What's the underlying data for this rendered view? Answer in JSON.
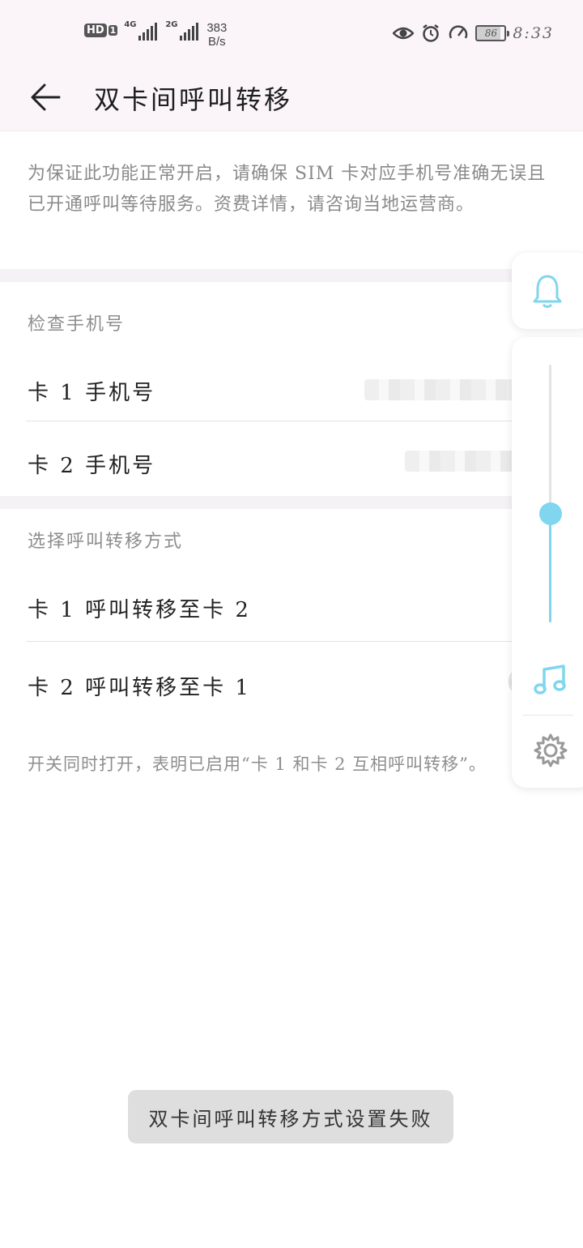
{
  "status_bar": {
    "hd_badge": "HD",
    "hd_sim": "1",
    "sim1_network": "4G",
    "sim2_network": "2G",
    "speed_value": "383",
    "speed_unit": "B/s",
    "battery_level": "86",
    "time": "8:33",
    "icons": [
      "eye-icon",
      "alarm-icon",
      "speedometer-icon",
      "battery-icon"
    ]
  },
  "header": {
    "back_icon": "arrow-left-icon",
    "title": "双卡间呼叫转移"
  },
  "intro_text": "为保证此功能正常开启，请确保 SIM 卡对应手机号准确无误且已开通呼叫等待服务。资费详情，请咨询当地运营商。",
  "check_numbers": {
    "section_label": "检查手机号",
    "items": [
      {
        "label": "卡 1 手机号"
      },
      {
        "label": "卡 2 手机号"
      }
    ]
  },
  "forwarding_mode": {
    "section_label": "选择呼叫转移方式",
    "items": [
      {
        "label": "卡 1 呼叫转移至卡 2"
      },
      {
        "label": "卡 2 呼叫转移至卡 1"
      }
    ]
  },
  "note": "开关同时打开，表明已启用“卡 1 和卡 2 互相呼叫转移”。",
  "volume_panel": {
    "icons": [
      "bell-icon",
      "music-note-icon",
      "gear-icon"
    ],
    "level": 0.42,
    "accent_color": "#7fd6ee"
  },
  "toast": "双卡间呼叫转移方式设置失败"
}
